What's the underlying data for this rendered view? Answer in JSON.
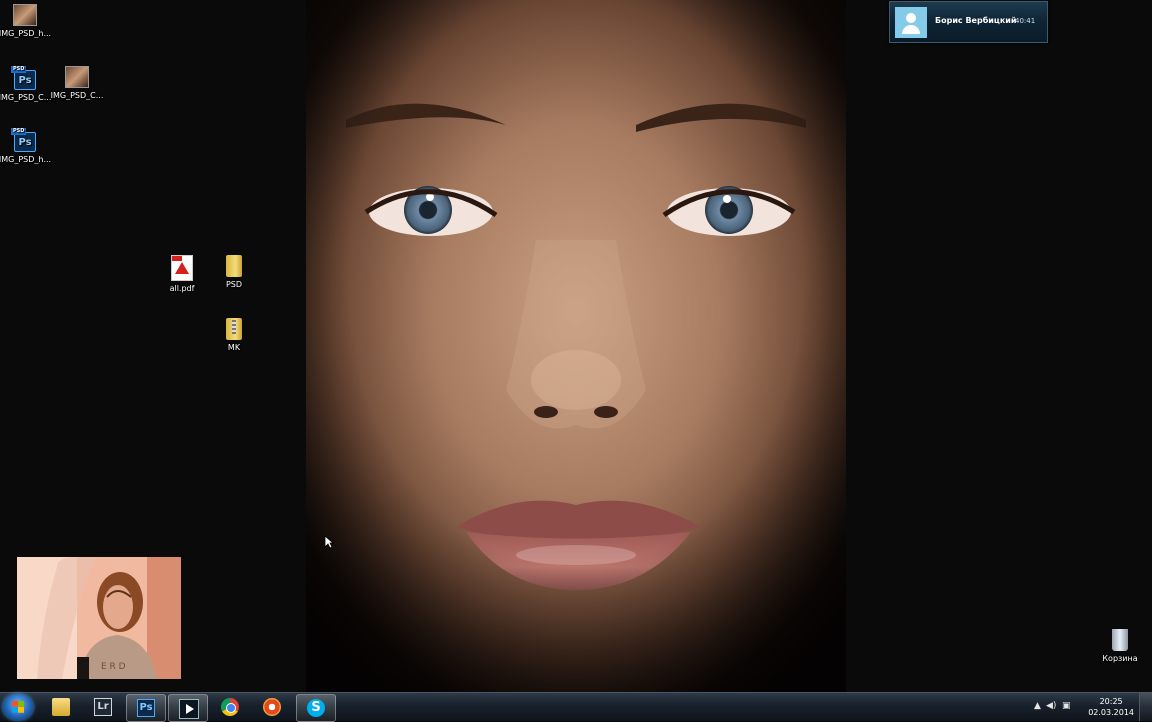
{
  "desktop": {
    "icons": [
      {
        "label": "IMG_PSD_h...",
        "icon": "image-thumbnail-icon"
      },
      {
        "label": "IMG_PSD_C...",
        "icon": "photoshop-file-icon"
      },
      {
        "label": "IMG_PSD_C...",
        "icon": "image-thumbnail-icon"
      },
      {
        "label": "IMG_PSD_h...",
        "icon": "photoshop-file-icon"
      },
      {
        "label": "all.pdf",
        "icon": "pdf-file-icon"
      },
      {
        "label": "PSD",
        "icon": "folder-icon"
      },
      {
        "label": "MK",
        "icon": "zip-folder-icon"
      },
      {
        "label": "Корзина",
        "icon": "recycle-bin-icon"
      }
    ]
  },
  "notification": {
    "name": "Борис Вербицкий",
    "time": "40:41",
    "accent": "#84cbea"
  },
  "taskbar": {
    "apps": [
      {
        "name": "Windows Explorer",
        "icon": "folder-icon"
      },
      {
        "name": "Lightroom",
        "icon": "lightroom-icon",
        "glyph": "Lr"
      },
      {
        "name": "Photoshop",
        "icon": "photoshop-icon",
        "glyph": "Ps",
        "active": true
      },
      {
        "name": "Media Player",
        "icon": "media-player-icon"
      },
      {
        "name": "Chrome",
        "icon": "chrome-icon"
      },
      {
        "name": "Eye app",
        "icon": "eye-icon"
      },
      {
        "name": "Skype",
        "icon": "skype-icon",
        "glyph": "S"
      }
    ],
    "tray": {
      "time": "20:25",
      "date": "02.03.2014"
    }
  }
}
